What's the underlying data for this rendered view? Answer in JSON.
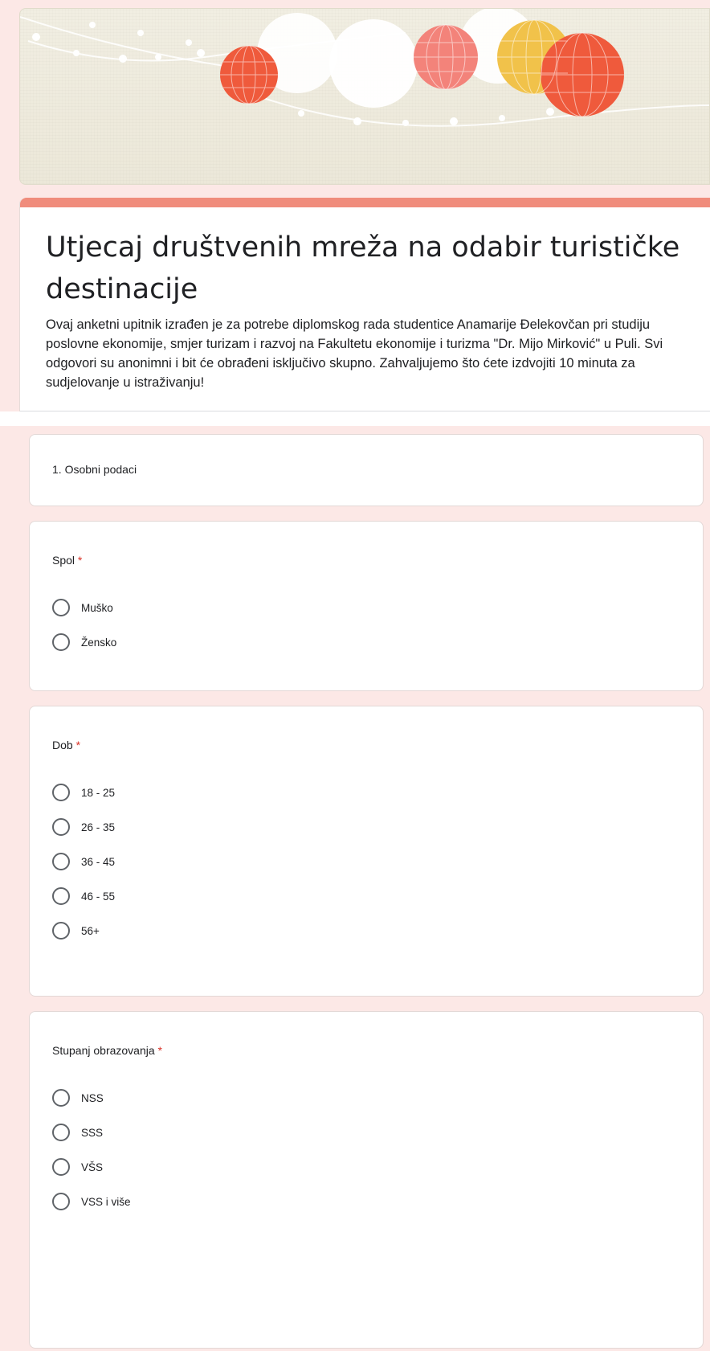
{
  "form": {
    "title": "Utjecaj društvenih mreža na odabir turističke destinacije",
    "description": "Ovaj anketni upitnik izrađen je za potrebe diplomskog rada studentice Anamarije Đelekovčan pri studiju poslovne  ekonomije, smjer turizam i razvoj na Fakultetu ekonomije i turizma \"Dr. Mijo Mirković\" u Puli. Svi odgovori su anonimni i bit će obrađeni isključivo skupno. Zahvaljujemo što ćete izdvojiti 10 minuta za sudjelovanje u istraživanju!",
    "accent_color": "#f08c7c"
  },
  "section": {
    "title": "1. Osobni podaci"
  },
  "questions": [
    {
      "title": "Spol",
      "required_mark": "*",
      "options": [
        "Muško",
        "Žensko"
      ]
    },
    {
      "title": "Dob",
      "required_mark": "*",
      "options": [
        "18 - 25",
        "26 - 35",
        "36 - 45",
        "46 - 55",
        "56+"
      ]
    },
    {
      "title": "Stupanj obrazovanja",
      "required_mark": "*",
      "options": [
        "NSS",
        "SSS",
        "VŠS",
        "VSS i više"
      ]
    }
  ],
  "colors": {
    "page_background": "#fce8e6",
    "required": "#d93025",
    "lantern_red": "#ef5a3c",
    "lantern_pink": "#f3837a",
    "lantern_yellow": "#f1c24a",
    "lantern_white": "#ffffff"
  },
  "icons": {
    "radio": "radio-unchecked-icon"
  }
}
